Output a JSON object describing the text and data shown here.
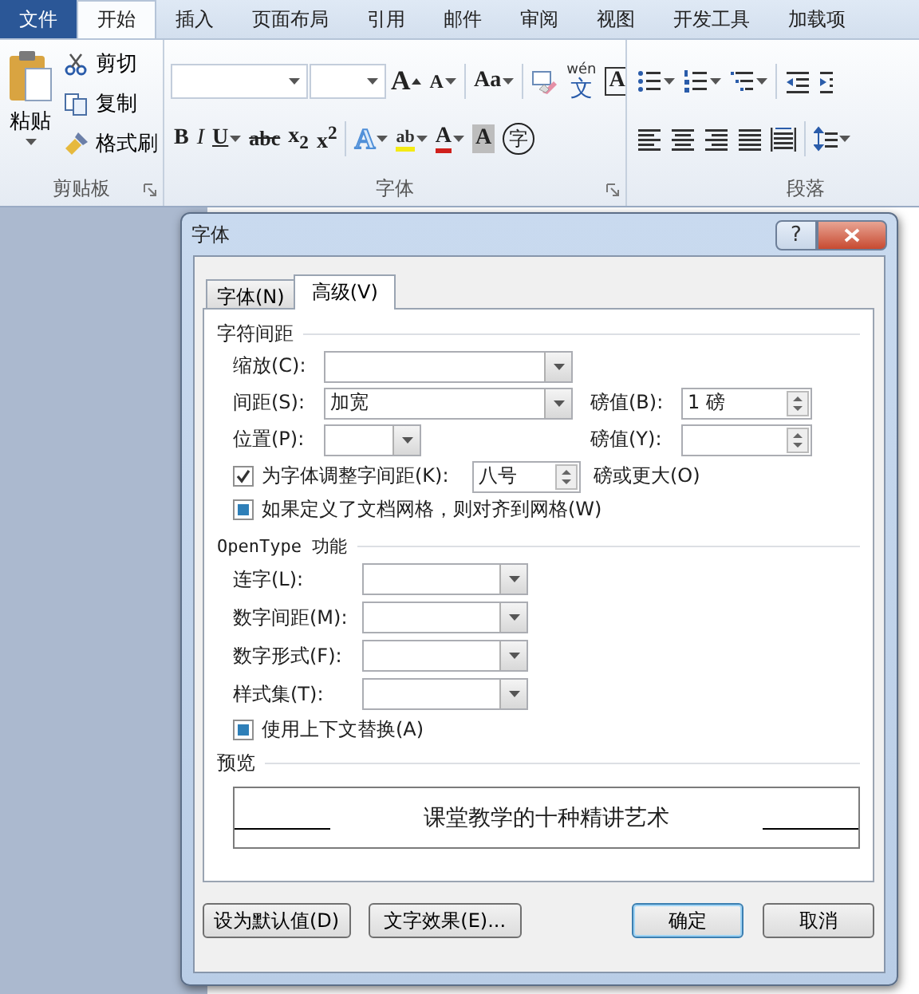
{
  "ribbon_tabs": [
    {
      "label": "文件",
      "kind": "file",
      "selected": false
    },
    {
      "label": "开始",
      "kind": "tab",
      "selected": true
    },
    {
      "label": "插入",
      "kind": "tab",
      "selected": false
    },
    {
      "label": "页面布局",
      "kind": "tab",
      "selected": false
    },
    {
      "label": "引用",
      "kind": "tab",
      "selected": false
    },
    {
      "label": "邮件",
      "kind": "tab",
      "selected": false
    },
    {
      "label": "审阅",
      "kind": "tab",
      "selected": false
    },
    {
      "label": "视图",
      "kind": "tab",
      "selected": false
    },
    {
      "label": "开发工具",
      "kind": "tab",
      "selected": false
    },
    {
      "label": "加载项",
      "kind": "tab",
      "selected": false
    }
  ],
  "clipboard": {
    "title": "剪贴板",
    "paste": "粘贴",
    "items": [
      {
        "label": "剪切",
        "kind": "scissors"
      },
      {
        "label": "复制",
        "kind": "copy"
      },
      {
        "label": "格式刷",
        "kind": "brush"
      }
    ]
  },
  "font_group": {
    "title": "字体",
    "row1": [
      {
        "kind": "combo"
      },
      {
        "kind": "combo-small"
      },
      {
        "kind": "grow",
        "label": "A"
      },
      {
        "kind": "shrink",
        "label": "A"
      },
      {
        "kind": "sep"
      },
      {
        "kind": "case",
        "label": "Aa"
      },
      {
        "kind": "sep"
      },
      {
        "kind": "clear"
      },
      {
        "kind": "phonetic",
        "label": "文",
        "ruby": "wén"
      },
      {
        "kind": "border",
        "label": "A"
      }
    ],
    "row2": [
      {
        "kind": "bold",
        "label": "B"
      },
      {
        "kind": "italic",
        "label": "I"
      },
      {
        "kind": "underline",
        "label": "U"
      },
      {
        "kind": "strike",
        "label": "abc"
      },
      {
        "kind": "sub",
        "label": "x$_{2}$"
      },
      {
        "kind": "super",
        "label": "x$^{2}$"
      },
      {
        "kind": "sep"
      },
      {
        "kind": "effects",
        "label": "A"
      },
      {
        "kind": "highlight",
        "label": "ab"
      },
      {
        "kind": "color",
        "label": "A"
      },
      {
        "kind": "shading",
        "label": "A"
      },
      {
        "kind": "enclose",
        "label": "字"
      }
    ]
  },
  "paragraph_group": {
    "title": "段落",
    "row1": [
      {
        "kind": "bullets"
      },
      {
        "kind": "numbering"
      },
      {
        "kind": "multilevel"
      },
      {
        "kind": "sep"
      },
      {
        "kind": "outdent"
      },
      {
        "kind": "indent"
      }
    ],
    "row2": [
      {
        "kind": "align-left"
      },
      {
        "kind": "align-center"
      },
      {
        "kind": "align-right"
      },
      {
        "kind": "justify"
      },
      {
        "kind": "distribute"
      },
      {
        "kind": "sep"
      },
      {
        "kind": "line-spacing"
      }
    ]
  },
  "dialog": {
    "title": "字体",
    "help": "?",
    "tabs": [
      {
        "label": "字体(N)",
        "selected": false
      },
      {
        "label": "高级(V)",
        "selected": true
      }
    ],
    "spacing": {
      "title": "字符间距",
      "scale": {
        "label": "缩放(C):"
      },
      "spacing": {
        "label": "间距(S):",
        "value": "加宽",
        "by_label": "磅值(B):",
        "by_value": "1 磅"
      },
      "position": {
        "label": "位置(P):",
        "by_label": "磅值(Y):"
      },
      "kerning": {
        "label": "为字体调整字间距(K):",
        "checked": true,
        "value": "八号",
        "suffix": "磅或更大(O)"
      },
      "snap_to_grid": {
        "label": "如果定义了文档网格，则对齐到网格(W)",
        "checked": false,
        "indeterminate": true
      }
    },
    "opentype": {
      "title": "OpenType 功能",
      "fields": [
        {
          "label": "连字(L):"
        },
        {
          "label": "数字间距(M):"
        },
        {
          "label": "数字形式(F):"
        },
        {
          "label": "样式集(T):"
        }
      ],
      "contextual": {
        "label": "使用上下文替换(A)",
        "checked": false,
        "indeterminate": true
      }
    },
    "preview": {
      "title": "预览",
      "text": "课堂教学的十种精讲艺术"
    },
    "buttons": [
      {
        "label": "设为默认值(D)",
        "default": false
      },
      {
        "label": "文字效果(E)...",
        "default": false
      },
      {
        "label": "确定",
        "default": true
      },
      {
        "label": "取消",
        "default": false
      }
    ]
  }
}
